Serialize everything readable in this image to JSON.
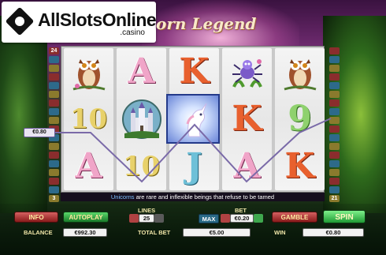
{
  "logo": {
    "text": "AllSlotsOnline",
    "suffix": ".casino"
  },
  "game_title": "orn Legend",
  "paylines_left": [
    "24",
    "",
    "",
    "",
    "",
    "",
    "",
    "",
    "",
    "",
    "",
    "",
    "",
    "",
    "",
    "",
    "",
    "3"
  ],
  "paylines_right": [
    "",
    "",
    "",
    "",
    "",
    "",
    "",
    "",
    "",
    "",
    "",
    "",
    "",
    "",
    "",
    "",
    "",
    "21"
  ],
  "reels": [
    [
      "owl",
      "10",
      "A"
    ],
    [
      "A",
      "castle",
      "10"
    ],
    [
      "K",
      "unicorn",
      "J"
    ],
    [
      "spider",
      "K",
      "A"
    ],
    [
      "owl",
      "9",
      "K"
    ]
  ],
  "win_line_amount": "€0.80",
  "message": {
    "highlight": "Unicorns",
    "rest": " are rare and inflexible beings that refuse to be tamed"
  },
  "controls": {
    "info_label": "INFO",
    "autoplay_label": "AUTOPLAY",
    "lines_label": "LINES",
    "lines_value": "25",
    "bet_label": "BET",
    "bet_value": "€0.20",
    "max_label": "MAX",
    "gamble_label": "GAMBLE",
    "spin_label": "SPIN",
    "balance_label": "BALANCE",
    "balance_value": "€992.30",
    "total_bet_label": "TOTAL BET",
    "total_bet_value": "€5.00",
    "win_label": "WIN",
    "win_value": "€0.80"
  },
  "colors": {
    "accent_text": "#f0e6a8",
    "win_line": "#7a6aa8"
  }
}
